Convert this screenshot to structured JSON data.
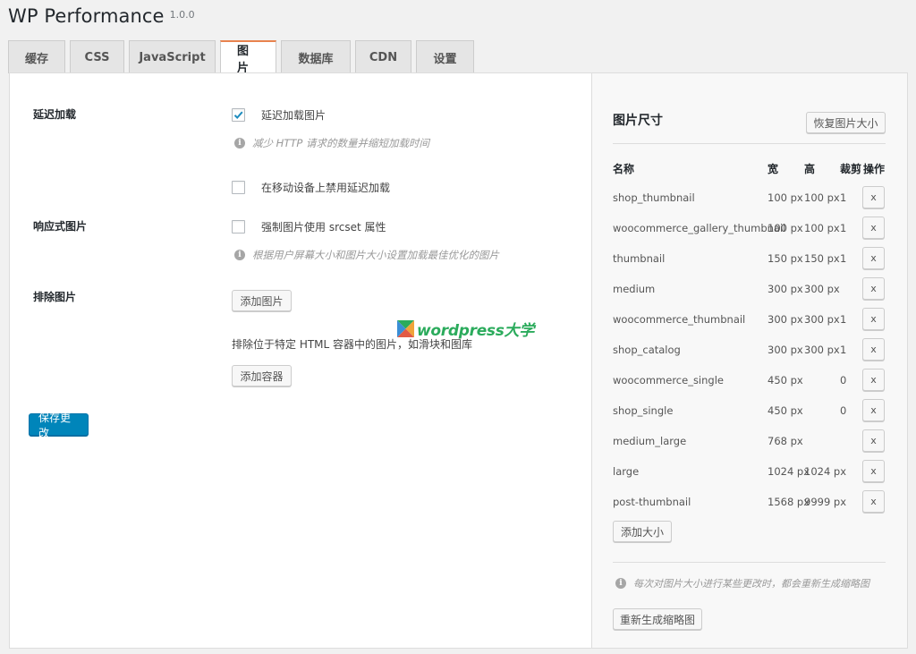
{
  "app": {
    "title": "WP Performance",
    "version": "1.0.0"
  },
  "tabs": [
    {
      "label": "缓存",
      "active": false
    },
    {
      "label": "CSS",
      "active": false
    },
    {
      "label": "JavaScript",
      "active": false
    },
    {
      "label": "图片",
      "active": true
    },
    {
      "label": "数据库",
      "active": false
    },
    {
      "label": "CDN",
      "active": false
    },
    {
      "label": "设置",
      "active": false
    }
  ],
  "settings": {
    "lazy_load": {
      "label": "延迟加载",
      "option_label": "延迟加载图片",
      "checked": true,
      "hint": "减少 HTTP 请求的数量并缩短加载时间",
      "mobile_option_label": "在移动设备上禁用延迟加载",
      "mobile_checked": false
    },
    "responsive": {
      "label": "响应式图片",
      "option_label": "强制图片使用 srcset 属性",
      "checked": false,
      "hint": "根据用户屏幕大小和图片大小设置加载最佳优化的图片"
    },
    "exclude": {
      "label": "排除图片",
      "add_image_button": "添加图片",
      "description": "排除位于特定 HTML 容器中的图片，如滑块和图库",
      "add_container_button": "添加容器"
    },
    "save_button": "保存更改"
  },
  "watermark": {
    "text": "wordpress大学"
  },
  "image_sizes": {
    "title": "图片尺寸",
    "restore_button": "恢复图片大小",
    "columns": {
      "name": "名称",
      "width": "宽",
      "height": "高",
      "crop": "裁剪",
      "action": "操作"
    },
    "rows": [
      {
        "name": "shop_thumbnail",
        "width": "100 px",
        "height": "100 px",
        "crop": "1",
        "action": "x"
      },
      {
        "name": "woocommerce_gallery_thumbnail",
        "width": "100 px",
        "height": "100 px",
        "crop": "1",
        "action": "x"
      },
      {
        "name": "thumbnail",
        "width": "150 px",
        "height": "150 px",
        "crop": "1",
        "action": "x"
      },
      {
        "name": "medium",
        "width": "300 px",
        "height": "300 px",
        "crop": "",
        "action": "x"
      },
      {
        "name": "woocommerce_thumbnail",
        "width": "300 px",
        "height": "300 px",
        "crop": "1",
        "action": "x"
      },
      {
        "name": "shop_catalog",
        "width": "300 px",
        "height": "300 px",
        "crop": "1",
        "action": "x"
      },
      {
        "name": "woocommerce_single",
        "width": "450 px",
        "height": "",
        "crop": "0",
        "action": "x"
      },
      {
        "name": "shop_single",
        "width": "450 px",
        "height": "",
        "crop": "0",
        "action": "x"
      },
      {
        "name": "medium_large",
        "width": "768 px",
        "height": "",
        "crop": "",
        "action": "x"
      },
      {
        "name": "large",
        "width": "1024 px",
        "height": "1024 px",
        "crop": "",
        "action": "x"
      },
      {
        "name": "post-thumbnail",
        "width": "1568 px",
        "height": "9999 px",
        "crop": "",
        "action": "x"
      }
    ],
    "add_size_button": "添加大小",
    "note": "每次对图片大小进行某些更改时，都会重新生成缩略图",
    "regenerate_button": "重新生成缩略图"
  },
  "colors": {
    "accent": "#e8834e",
    "primary_button": "#0085ba",
    "watermark_green": "#2bab5c"
  }
}
